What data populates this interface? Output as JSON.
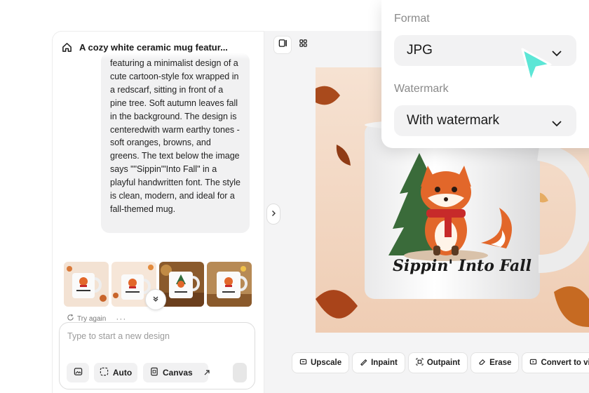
{
  "left_panel": {
    "title": "A cozy white ceramic mug featur...",
    "prompt_text": "featuring a minimalist design of a cute cartoon-style fox wrapped in a redscarf, sitting in front of a pine tree. Soft autumn leaves fall in the background. The design is centeredwith warm earthy tones - soft oranges, browns, and greens. The text below the image says \"\"Sippin'\"Into Fall\" in a playful handwritten font. The style is clean, modern, and ideal for a fall-themed mug.",
    "try_again": "Try again",
    "composer": {
      "placeholder": "Type to start a new design",
      "auto_label": "Auto",
      "canvas_label": "Canvas"
    }
  },
  "preview": {
    "mug_text": "Sippin' Into Fall"
  },
  "toolbar": {
    "upscale": "Upscale",
    "inpaint": "Inpaint",
    "outpaint": "Outpaint",
    "erase": "Erase",
    "convert": "Convert to vi"
  },
  "export_popover": {
    "format_label": "Format",
    "format_value": "JPG",
    "watermark_label": "Watermark",
    "watermark_value": "With watermark"
  },
  "colors": {
    "cursor": "#5ce6d6",
    "canvas_bg": "#f4f4f5",
    "image_bg": "#f2d9c6"
  }
}
